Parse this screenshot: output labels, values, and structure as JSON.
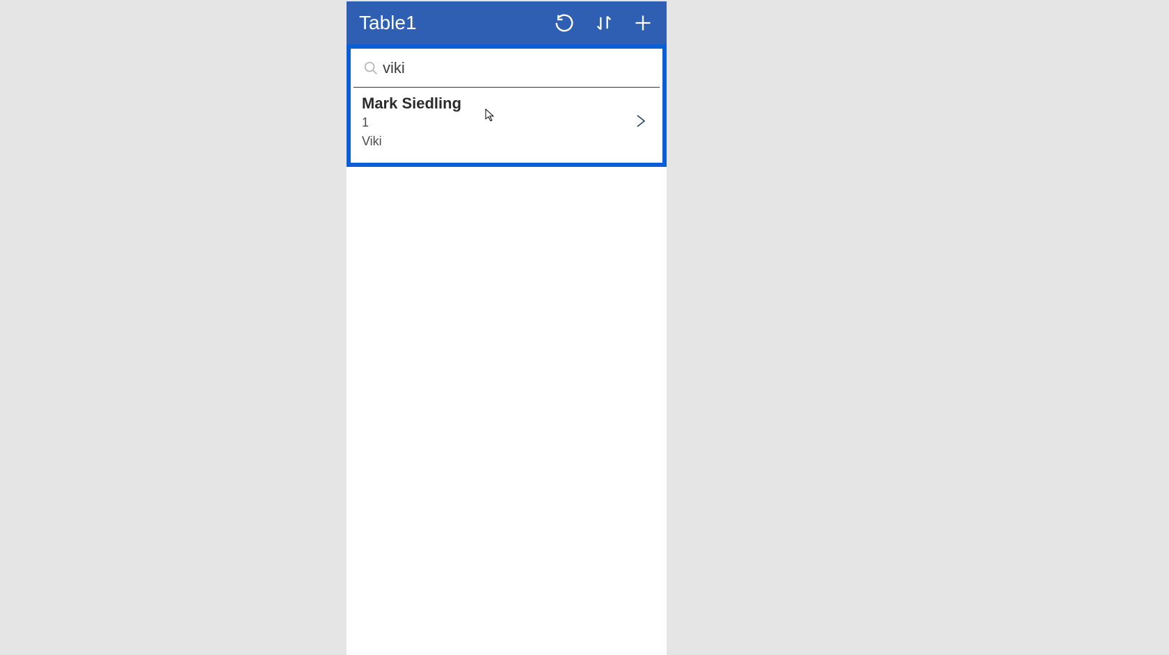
{
  "header": {
    "title": "Table1"
  },
  "search": {
    "value": "viki",
    "placeholder": ""
  },
  "results": [
    {
      "title": "Mark Siedling",
      "line2": "1",
      "line3": "Viki"
    }
  ],
  "colors": {
    "header_bg": "#2f5fb3",
    "highlight_border": "#0b5fd6",
    "chevron": "#1a3a63"
  }
}
